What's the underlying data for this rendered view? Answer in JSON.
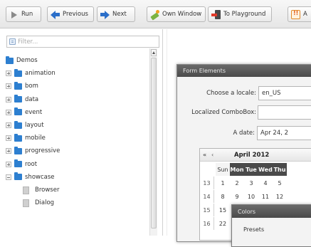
{
  "toolbar": {
    "run": "Run",
    "previous": "Previous",
    "next": "Next",
    "own_window": "Own Window",
    "to_playground": "To Playground",
    "api_partial": "A"
  },
  "filter": {
    "placeholder": "Filter..."
  },
  "tree": [
    {
      "label": "Demos",
      "kind": "folder",
      "expander": "none",
      "level": 0
    },
    {
      "label": "animation",
      "kind": "folder",
      "expander": "plus",
      "level": 0
    },
    {
      "label": "bom",
      "kind": "folder",
      "expander": "plus",
      "level": 0
    },
    {
      "label": "data",
      "kind": "folder",
      "expander": "plus",
      "level": 0
    },
    {
      "label": "event",
      "kind": "folder",
      "expander": "plus",
      "level": 0
    },
    {
      "label": "layout",
      "kind": "folder",
      "expander": "plus",
      "level": 0
    },
    {
      "label": "mobile",
      "kind": "folder",
      "expander": "plus",
      "level": 0
    },
    {
      "label": "progressive",
      "kind": "folder",
      "expander": "plus",
      "level": 0
    },
    {
      "label": "root",
      "kind": "folder",
      "expander": "plus",
      "level": 0
    },
    {
      "label": "showcase",
      "kind": "folder",
      "expander": "minus",
      "level": 0
    },
    {
      "label": "Browser",
      "kind": "file",
      "expander": "none",
      "level": 1
    },
    {
      "label": "Dialog",
      "kind": "file",
      "expander": "none",
      "level": 1
    }
  ],
  "form_window": {
    "title": "Form Elements",
    "locale_label": "Choose a locale:",
    "locale_value": "en_US",
    "combo_label": "Localized ComboBox:",
    "combo_value": "",
    "date_label": "A date:",
    "date_value": "Apr 24, 2"
  },
  "calendar": {
    "prev_year": "«",
    "prev_month": "‹",
    "title": "April 2012",
    "headers": [
      "Sun",
      "Mon",
      "Tue",
      "Wed",
      "Thu"
    ],
    "rows": [
      {
        "week": "13",
        "days": [
          "1",
          "2",
          "3",
          "4",
          "5"
        ]
      },
      {
        "week": "14",
        "days": [
          "8",
          "9",
          "10",
          "11",
          "12"
        ]
      },
      {
        "week": "15",
        "days": [
          "15",
          "16",
          "",
          "",
          ""
        ]
      },
      {
        "week": "16",
        "days": [
          "22",
          "23",
          "",
          "",
          ""
        ]
      }
    ]
  },
  "colors_window": {
    "title": "Colors",
    "presets_label": "Presets"
  }
}
